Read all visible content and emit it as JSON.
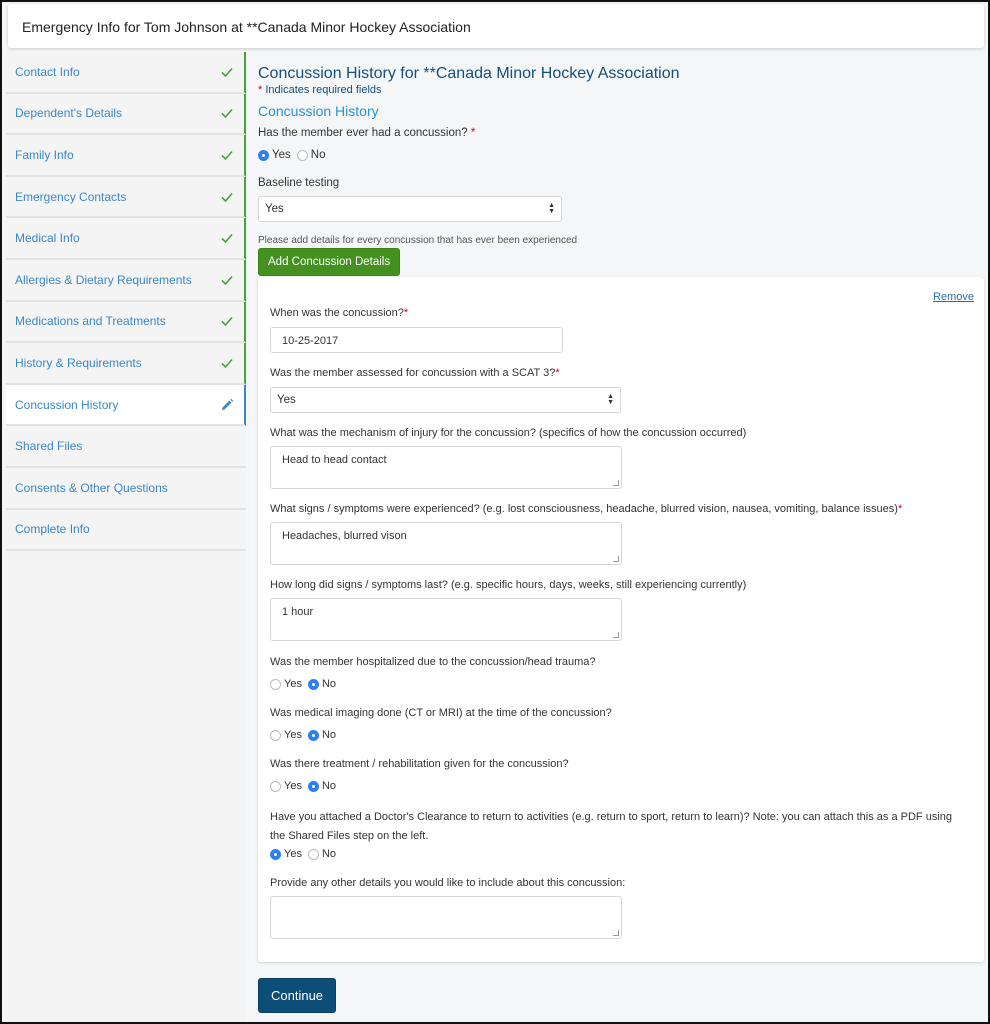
{
  "header": {
    "title": "Emergency Info for Tom Johnson at **Canada Minor Hockey Association"
  },
  "sidebar": {
    "items": [
      {
        "label": "Contact Info",
        "status": "done"
      },
      {
        "label": "Dependent's Details",
        "status": "done"
      },
      {
        "label": "Family Info",
        "status": "done"
      },
      {
        "label": "Emergency Contacts",
        "status": "done"
      },
      {
        "label": "Medical Info",
        "status": "done"
      },
      {
        "label": "Allergies & Dietary Requirements",
        "status": "done"
      },
      {
        "label": "Medications and Treatments",
        "status": "done"
      },
      {
        "label": "History & Requirements",
        "status": "done"
      },
      {
        "label": "Concussion History",
        "status": "active"
      },
      {
        "label": "Shared Files",
        "status": "pending"
      },
      {
        "label": "Consents & Other Questions",
        "status": "pending"
      },
      {
        "label": "Complete Info",
        "status": "pending"
      }
    ]
  },
  "colors": {
    "done": "#4aa13c",
    "active": "#3a87c8",
    "primary": "#0d4e79",
    "add": "#44911f"
  },
  "main": {
    "title": "Concussion History for **Canada Minor Hockey Association",
    "required_note": "Indicates required fields",
    "section_title": "Concussion History",
    "had_concussion": {
      "label": "Has the member ever had a concussion?",
      "required": "*",
      "options": [
        "Yes",
        "No"
      ],
      "selected": "Yes"
    },
    "baseline": {
      "label": "Baseline testing",
      "value": "Yes"
    },
    "hint": "Please add details for every concussion that has ever been experienced",
    "add_button": "Add Concussion Details"
  },
  "card": {
    "remove": "Remove",
    "when": {
      "label": "When was the concussion?",
      "required": "*",
      "value": "10-25-2017"
    },
    "scat3": {
      "label": "Was the member assessed for concussion with a SCAT 3?",
      "required": "*",
      "value": "Yes"
    },
    "mechanism": {
      "label": "What was the mechanism of injury for the concussion? (specifics of how the concussion occurred)",
      "value": "Head to head contact"
    },
    "symptoms": {
      "label": "What signs / symptoms were experienced? (e.g. lost consciousness, headache, blurred vision, nausea, vomiting, balance issues)",
      "required": "*",
      "value": "Headaches, blurred vison"
    },
    "duration": {
      "label": "How long did signs / symptoms last? (e.g. specific hours, days, weeks, still experiencing currently)",
      "value": "1 hour"
    },
    "hospitalized": {
      "label": "Was the member hospitalized due to the concussion/head trauma?",
      "options": [
        "Yes",
        "No"
      ],
      "selected": "No"
    },
    "imaging": {
      "label": "Was medical imaging done (CT or MRI) at the time of the concussion?",
      "options": [
        "Yes",
        "No"
      ],
      "selected": "No"
    },
    "treatment": {
      "label": "Was there treatment / rehabilitation given for the concussion?",
      "options": [
        "Yes",
        "No"
      ],
      "selected": "No"
    },
    "clearance": {
      "label_line1": "Have you attached a Doctor's Clearance to return to activities (e.g. return to sport, return to learn)? Note: you can attach this as a PDF using",
      "label_line2": "the Shared Files step on the left.",
      "options": [
        "Yes",
        "No"
      ],
      "selected": "Yes"
    },
    "other": {
      "label": "Provide any other details you would like to include about this concussion:",
      "value": ""
    }
  },
  "footer": {
    "continue": "Continue"
  }
}
